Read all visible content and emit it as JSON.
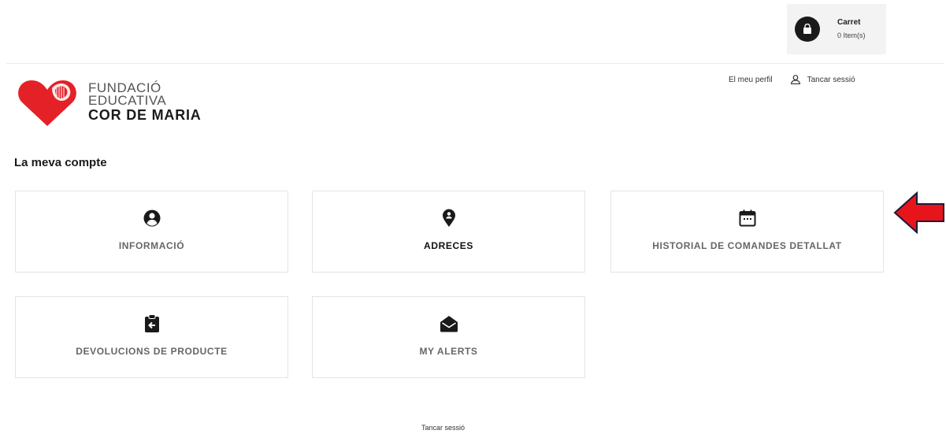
{
  "cart": {
    "title": "Carret",
    "count": "0 Item(s)",
    "icon": "shopping-bag-icon"
  },
  "logo": {
    "line1": "FUNDACIÓ",
    "line2": "EDUCATIVA",
    "line3": "COR DE MARIA",
    "icon": "heart-logo-icon",
    "color": "#e52128"
  },
  "header": {
    "profile": "El meu perfil",
    "logout": "Tancar sessió",
    "logout_icon": "user-icon"
  },
  "page": {
    "title": "La meva compte"
  },
  "cards": [
    {
      "label": "INFORMACIÓ",
      "icon": "user-circle-icon"
    },
    {
      "label": "ADRECES",
      "icon": "map-pin-icon"
    },
    {
      "label": "HISTORIAL DE COMANDES DETALLAT",
      "icon": "calendar-icon"
    },
    {
      "label": "DEVOLUCIONS DE PRODUCTE",
      "icon": "clipboard-return-icon"
    },
    {
      "label": "MY ALERTS",
      "icon": "envelope-open-icon"
    }
  ],
  "annotation": {
    "icon": "red-arrow-icon",
    "color": "#e8141c"
  },
  "footer": {
    "logout": "Tancar sessió"
  }
}
